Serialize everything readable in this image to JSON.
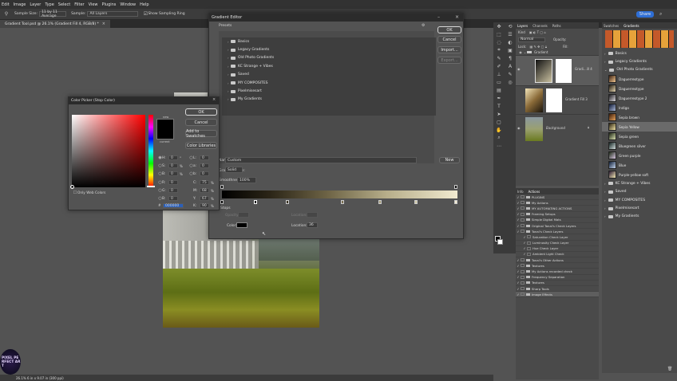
{
  "menu": [
    "Edit",
    "Image",
    "Layer",
    "Type",
    "Select",
    "Filter",
    "View",
    "Plugins",
    "Window",
    "Help"
  ],
  "options": {
    "sample_size_label": "Sample Size:",
    "sample_size": "11 by 11 Average",
    "sample_label": "Sample:",
    "sample": "All Layers",
    "show_ring": "Show Sampling Ring",
    "share": "Share"
  },
  "doc_tab": "Gradient Tool.psd @ 26.1% (Gradient Fill 4, RGB/8) *",
  "status": "26.1%   6 in x 9.07 in (300 ppi)",
  "logo_text": "PIXEL PERFECT ART",
  "gradient_editor": {
    "title": "Gradient Editor",
    "presets_label": "Presets",
    "folders": [
      "Basics",
      "Legacy Gradients",
      "Old Photo Gradients",
      "KC Strange + Vibes",
      "Saved",
      "MY COMPOSITES",
      "Pixelmisesart",
      "My Gradients"
    ],
    "ok": "OK",
    "cancel": "Cancel",
    "import": "Import...",
    "export": "Export...",
    "name_label": "Name:",
    "name_value": "Custom",
    "new": "New",
    "type_label": "Gradient Type:",
    "type_value": "Solid",
    "smoothness_label": "Smoothness:",
    "smoothness_value": "100%",
    "stops_label": "Stops",
    "opacity_label": "Opacity:",
    "location_label": "Location:",
    "delete": "Delete",
    "color_label": "Color:",
    "location_value": "36",
    "colors": {
      "gradient_start": "#000000",
      "gradient_end": "#f1ead0",
      "stop_color": "#000000"
    }
  },
  "color_picker": {
    "title": "Color Picker (Stop Color)",
    "ok": "OK",
    "cancel": "Cancel",
    "add_swatches": "Add to Swatches",
    "color_libraries": "Color Libraries",
    "new_label": "new",
    "current_label": "current",
    "only_web": "Only Web Colors",
    "hsb": [
      {
        "k": "H:",
        "v": "0",
        "u": "°"
      },
      {
        "k": "S:",
        "v": "0",
        "u": "%"
      },
      {
        "k": "B:",
        "v": "0",
        "u": "%"
      }
    ],
    "rgb": [
      {
        "k": "R:",
        "v": "0"
      },
      {
        "k": "G:",
        "v": "0"
      },
      {
        "k": "B:",
        "v": "0"
      }
    ],
    "lab": [
      {
        "k": "L:",
        "v": "0"
      },
      {
        "k": "a:",
        "v": "0"
      },
      {
        "k": "b:",
        "v": "0"
      }
    ],
    "cmyk": [
      {
        "k": "C:",
        "v": "75",
        "u": "%"
      },
      {
        "k": "M:",
        "v": "68",
        "u": "%"
      },
      {
        "k": "Y:",
        "v": "67",
        "u": "%"
      },
      {
        "k": "K:",
        "v": "90",
        "u": "%"
      }
    ],
    "hex_label": "#",
    "hex": "000000"
  },
  "layers_panel": {
    "tabs": [
      "Layers",
      "Channels",
      "Paths"
    ],
    "kind_label": "Kind",
    "normal": "Normal",
    "opacity_label": "Opacity:",
    "fill_label": "Fill:",
    "lock_label": "Lock:",
    "layers": [
      "Gradient",
      "Gradi...ill 4",
      "Gradient Fill 3",
      "Background"
    ]
  },
  "actions_panel": {
    "tabs": [
      "Info",
      "Actions"
    ],
    "items": [
      "PLUGINS",
      "My Actions",
      "MY AUTOMATING ACTIONS",
      "Framing Setups",
      "Simple Digital Mats",
      "Original Tonal's Check Layers",
      "Tonal's Check Layers",
      "Saturation Check Layer",
      "Luminosity Check Layer",
      "Hue Check Layer",
      "Ambient Light Check",
      "Tonal's Other Actions",
      "Textures",
      "My Actions recorded check",
      "Frequency Separation",
      "Textures",
      "Sharp Tools",
      "Image Effects"
    ]
  },
  "gradients_panel": {
    "tabs": [
      "Swatches",
      "Gradients"
    ],
    "top_folders": [
      "Basics",
      "Legacy Gradients",
      "Old Photo Gradients"
    ],
    "items": [
      {
        "name": "Daguerreotype",
        "c1": "#3a2010",
        "c2": "#f2c690"
      },
      {
        "name": "Daguerreotype",
        "c1": "#231c12",
        "c2": "#e4d5b0"
      },
      {
        "name": "Daguerreotype 2",
        "c1": "#1f1e22",
        "c2": "#d9d6dc"
      },
      {
        "name": "Indigo",
        "c1": "#0e1833",
        "c2": "#aab8d8"
      },
      {
        "name": "Sepia brown",
        "c1": "#3a1a08",
        "c2": "#e6a25a"
      },
      {
        "name": "Sepia Yellow",
        "c1": "#2a2210",
        "c2": "#f2e4a6"
      },
      {
        "name": "Sepia green",
        "c1": "#1c2414",
        "c2": "#d8e0b0"
      },
      {
        "name": "Bluegreen silver",
        "c1": "#12211f",
        "c2": "#d2dede"
      },
      {
        "name": "Green purple",
        "c1": "#1d2a16",
        "c2": "#d8c6e2"
      },
      {
        "name": "Blue",
        "c1": "#0b1a33",
        "c2": "#c6d6ee"
      },
      {
        "name": "Purple-yellow soft",
        "c1": "#2a1a33",
        "c2": "#f4eab4"
      }
    ],
    "bottom_folders": [
      "KC Strange + Vibes",
      "Saved",
      "MY COMPOSITES",
      "Pixelmisesart",
      "My Gradients"
    ],
    "selected": "Sepia Yellow"
  }
}
